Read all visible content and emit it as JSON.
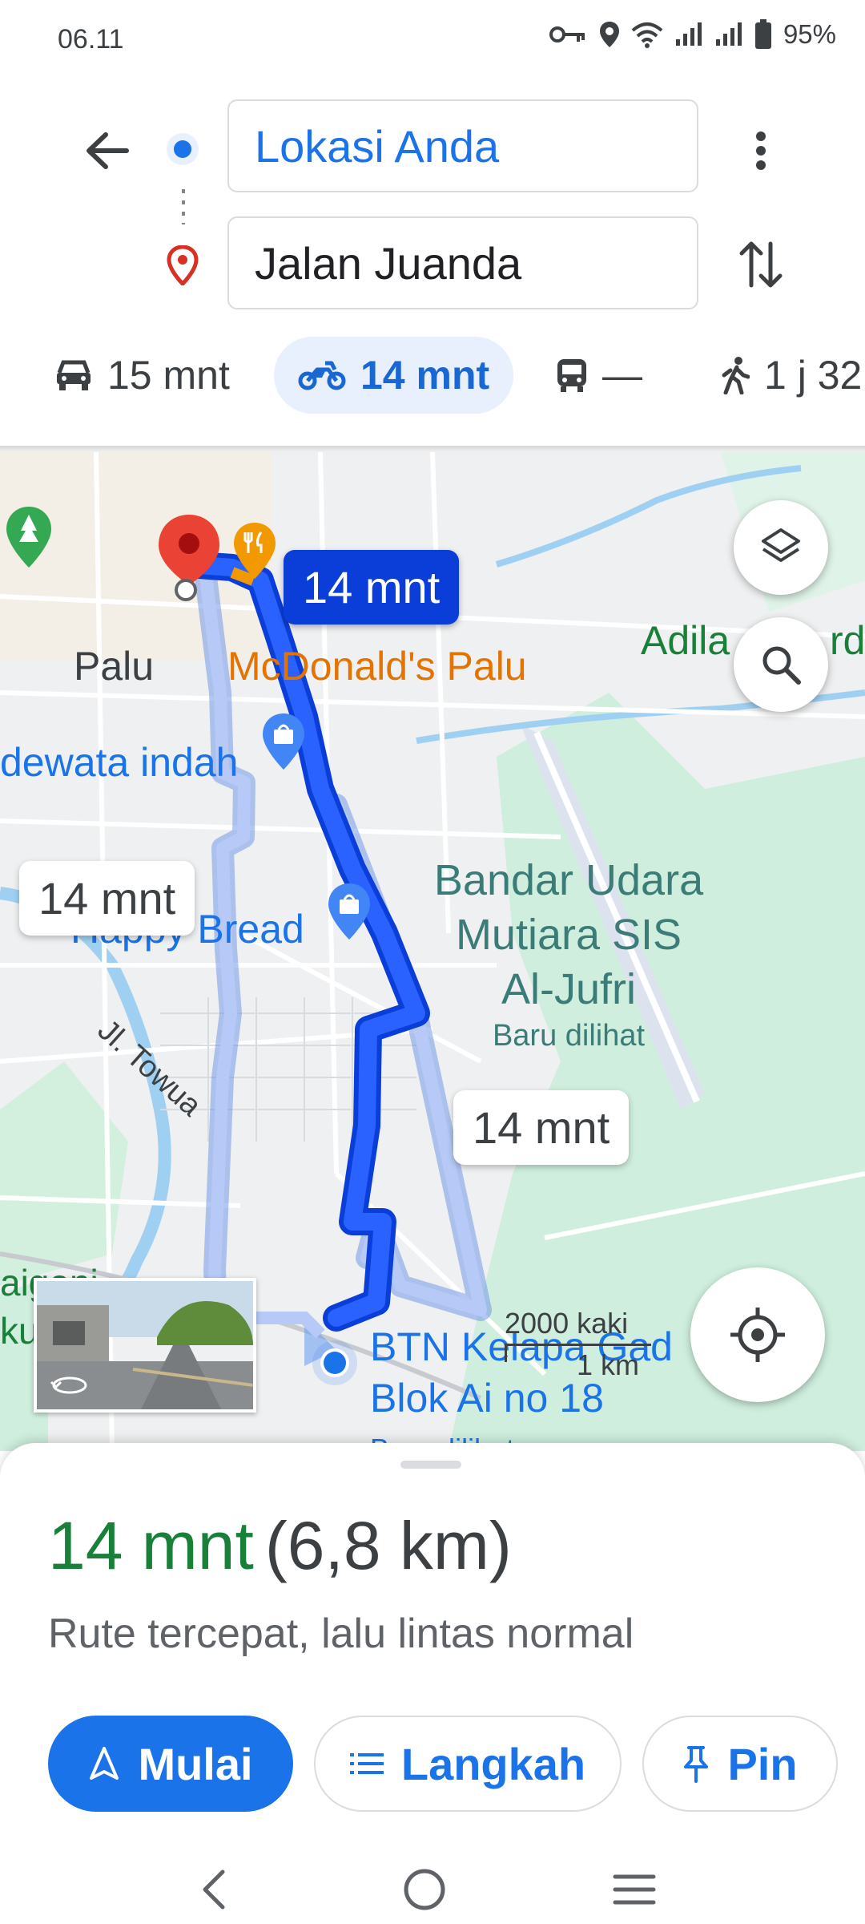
{
  "status_bar": {
    "time": "06.11",
    "battery": "95%",
    "icons": [
      "vpn-key-icon",
      "location-icon",
      "wifi-icon",
      "signal-icon",
      "signal-icon",
      "battery-icon"
    ]
  },
  "header": {
    "origin": "Lokasi Anda",
    "destination": "Jalan Juanda"
  },
  "modes": [
    {
      "icon": "car-icon",
      "label": "15 mnt",
      "active": false
    },
    {
      "icon": "motorcycle-icon",
      "label": "14 mnt",
      "active": true
    },
    {
      "icon": "transit-icon",
      "label": "—",
      "active": false
    },
    {
      "icon": "walk-icon",
      "label": "1 j 32"
    }
  ],
  "map": {
    "route_labels": {
      "selected": "14 mnt",
      "alt_left": "14 mnt",
      "alt_right": "14 mnt"
    },
    "places": {
      "city": "Palu",
      "mcdonalds": "McDonald's Palu",
      "dewata": "dewata indah",
      "bread": "Happy Bread",
      "street_towua": "Jl. Towua",
      "airport_line1": "Bandar Udara",
      "airport_line2": "Mutiara SIS",
      "airport_line3": "Al-Jufri",
      "airport_sub": "Baru dilihat",
      "adila": "Adila",
      "adila_tail": "rd",
      "btn_line1": "BTN Kelapa Gad",
      "btn_line2": "Blok Ai no 18",
      "btn_sub": "Baru dilihat",
      "left_cut1": "aigoni",
      "left_cut2": "ku"
    },
    "scale": {
      "top": "2000 kaki",
      "bottom": "1 km"
    }
  },
  "sheet": {
    "duration": "14 mnt",
    "distance": "(6,8 km)",
    "description": "Rute tercepat, lalu lintas normal",
    "buttons": {
      "start": "Mulai",
      "steps": "Langkah",
      "pin": "Pin"
    }
  },
  "colors": {
    "accent": "#1a73e8",
    "route_active": "#0b3ed8",
    "route_alt": "#a7bdf5",
    "duration_green": "#188038"
  }
}
